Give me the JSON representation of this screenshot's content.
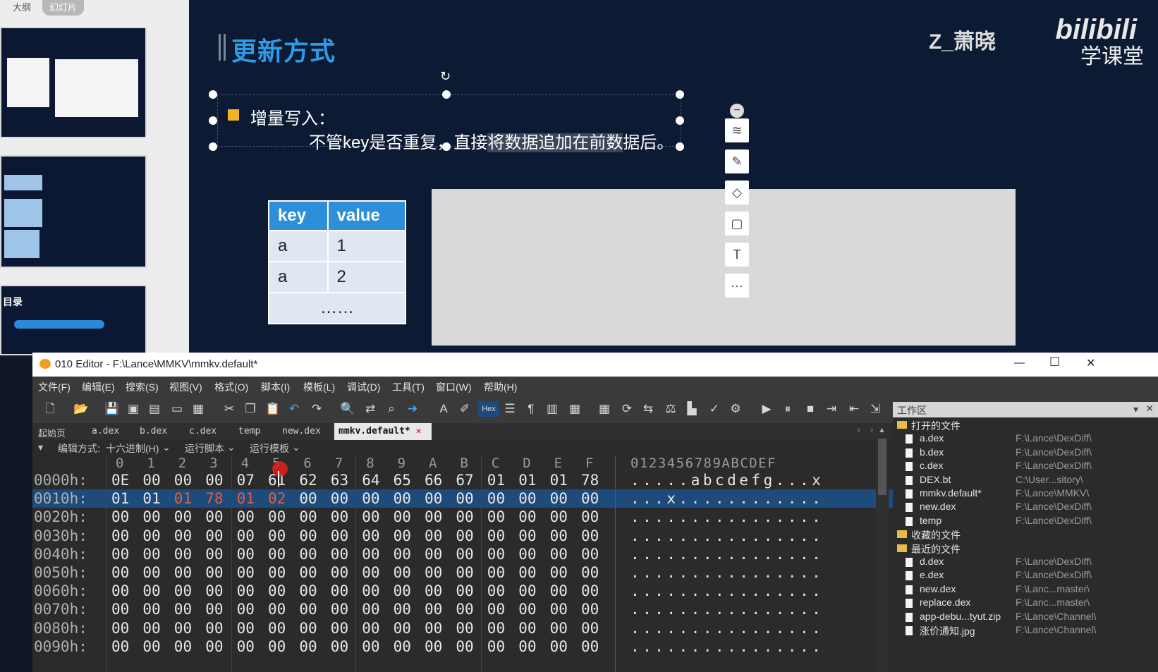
{
  "thumb_panel": {
    "tabs": [
      "大纲",
      "幻灯片"
    ],
    "thumb3_title": "目录"
  },
  "slide": {
    "title": "更新方式",
    "watermark_name": "Z_萧晓",
    "watermark_logo": "bilibili",
    "watermark_sub": "学课堂",
    "bullet_label": "增量写入：",
    "bullet_text_a": "不管key是否重复，直接",
    "bullet_text_hl": "将数据追加在前数",
    "bullet_text_b": "据后。",
    "table": {
      "headers": [
        "key",
        "value"
      ],
      "rows": [
        [
          "a",
          "1"
        ],
        [
          "a",
          "2"
        ]
      ],
      "ellipsis": "……"
    },
    "tools": [
      "minus-icon",
      "layers-icon",
      "pen-icon",
      "fill-icon",
      "crop-icon",
      "text-icon",
      "more-icon"
    ],
    "more_label": "···"
  },
  "editor": {
    "title": "010 Editor - F:\\Lance\\MMKV\\mmkv.default*",
    "window_controls": [
      "—",
      "☐",
      "✕"
    ],
    "menus": [
      "文件(F)",
      "编辑(E)",
      "搜索(S)",
      "视图(V)",
      "格式(O)",
      "脚本(I)",
      "模板(L)",
      "调试(D)",
      "工具(T)",
      "窗口(W)",
      "帮助(H)"
    ],
    "tabs": [
      "起始页",
      "a.dex",
      "b.dex",
      "c.dex",
      "temp",
      "new.dex"
    ],
    "active_tab": "mmkv.default*",
    "options": {
      "edit_mode_label": "编辑方式:",
      "edit_mode": "十六进制(H)",
      "run_script": "运行脚本",
      "run_template": "运行模板"
    },
    "col_headers": [
      "0",
      "1",
      "2",
      "3",
      "4",
      "5",
      "6",
      "7",
      "8",
      "9",
      "A",
      "B",
      "C",
      "D",
      "E",
      "F"
    ],
    "ascii_header": "0123456789ABCDEF",
    "rows": [
      {
        "addr": "0000h:",
        "bytes": [
          "0E",
          "00",
          "00",
          "00",
          "07",
          "61",
          "62",
          "63",
          "64",
          "65",
          "66",
          "67",
          "01",
          "01",
          "01",
          "78"
        ],
        "ascii": ".....abcdefg...x"
      },
      {
        "addr": "0010h:",
        "bytes": [
          "01",
          "01",
          "01",
          "78",
          "01",
          "02",
          "00",
          "00",
          "00",
          "00",
          "00",
          "00",
          "00",
          "00",
          "00",
          "00"
        ],
        "ascii": "...x............"
      },
      {
        "addr": "0020h:",
        "bytes": [
          "00",
          "00",
          "00",
          "00",
          "00",
          "00",
          "00",
          "00",
          "00",
          "00",
          "00",
          "00",
          "00",
          "00",
          "00",
          "00"
        ],
        "ascii": "................"
      },
      {
        "addr": "0030h:",
        "bytes": [
          "00",
          "00",
          "00",
          "00",
          "00",
          "00",
          "00",
          "00",
          "00",
          "00",
          "00",
          "00",
          "00",
          "00",
          "00",
          "00"
        ],
        "ascii": "................"
      },
      {
        "addr": "0040h:",
        "bytes": [
          "00",
          "00",
          "00",
          "00",
          "00",
          "00",
          "00",
          "00",
          "00",
          "00",
          "00",
          "00",
          "00",
          "00",
          "00",
          "00"
        ],
        "ascii": "................"
      },
      {
        "addr": "0050h:",
        "bytes": [
          "00",
          "00",
          "00",
          "00",
          "00",
          "00",
          "00",
          "00",
          "00",
          "00",
          "00",
          "00",
          "00",
          "00",
          "00",
          "00"
        ],
        "ascii": "................"
      },
      {
        "addr": "0060h:",
        "bytes": [
          "00",
          "00",
          "00",
          "00",
          "00",
          "00",
          "00",
          "00",
          "00",
          "00",
          "00",
          "00",
          "00",
          "00",
          "00",
          "00"
        ],
        "ascii": "................"
      },
      {
        "addr": "0070h:",
        "bytes": [
          "00",
          "00",
          "00",
          "00",
          "00",
          "00",
          "00",
          "00",
          "00",
          "00",
          "00",
          "00",
          "00",
          "00",
          "00",
          "00"
        ],
        "ascii": "................"
      },
      {
        "addr": "0080h:",
        "bytes": [
          "00",
          "00",
          "00",
          "00",
          "00",
          "00",
          "00",
          "00",
          "00",
          "00",
          "00",
          "00",
          "00",
          "00",
          "00",
          "00"
        ],
        "ascii": "................"
      },
      {
        "addr": "0090h:",
        "bytes": [
          "00",
          "00",
          "00",
          "00",
          "00",
          "00",
          "00",
          "00",
          "00",
          "00",
          "00",
          "00",
          "00",
          "00",
          "00",
          "00"
        ],
        "ascii": "................"
      }
    ],
    "highlighted_bytes_row1": [
      2,
      3,
      4,
      5
    ],
    "workspace": {
      "title": "工作区",
      "open_files_label": "打开的文件",
      "open_files": [
        {
          "name": "a.dex",
          "path": "F:\\Lance\\DexDiff\\"
        },
        {
          "name": "b.dex",
          "path": "F:\\Lance\\DexDiff\\"
        },
        {
          "name": "c.dex",
          "path": "F:\\Lance\\DexDiff\\"
        },
        {
          "name": "DEX.bt",
          "path": "C:\\User...sitory\\"
        },
        {
          "name": "mmkv.default*",
          "path": "F:\\Lance\\MMKV\\"
        },
        {
          "name": "new.dex",
          "path": "F:\\Lance\\DexDiff\\"
        },
        {
          "name": "temp",
          "path": "F:\\Lance\\DexDiff\\"
        }
      ],
      "favorites_label": "收藏的文件",
      "recent_label": "最近的文件",
      "recent_files": [
        {
          "name": "d.dex",
          "path": "F:\\Lance\\DexDiff\\"
        },
        {
          "name": "e.dex",
          "path": "F:\\Lance\\DexDiff\\"
        },
        {
          "name": "new.dex",
          "path": "F:\\Lanc...master\\"
        },
        {
          "name": "replace.dex",
          "path": "F:\\Lanc...master\\"
        },
        {
          "name": "app-debu...tyut.zip",
          "path": "F:\\Lance\\Channel\\"
        },
        {
          "name": "涨价通知.jpg",
          "path": "F:\\Lance\\Channel\\"
        }
      ]
    }
  },
  "colors": {
    "slide_bg": "#0c1a33",
    "title_blue": "#2d9be6",
    "table_header": "#2d8fd8",
    "selection": "#1e4a7c",
    "changed_byte": "#e0623a"
  }
}
